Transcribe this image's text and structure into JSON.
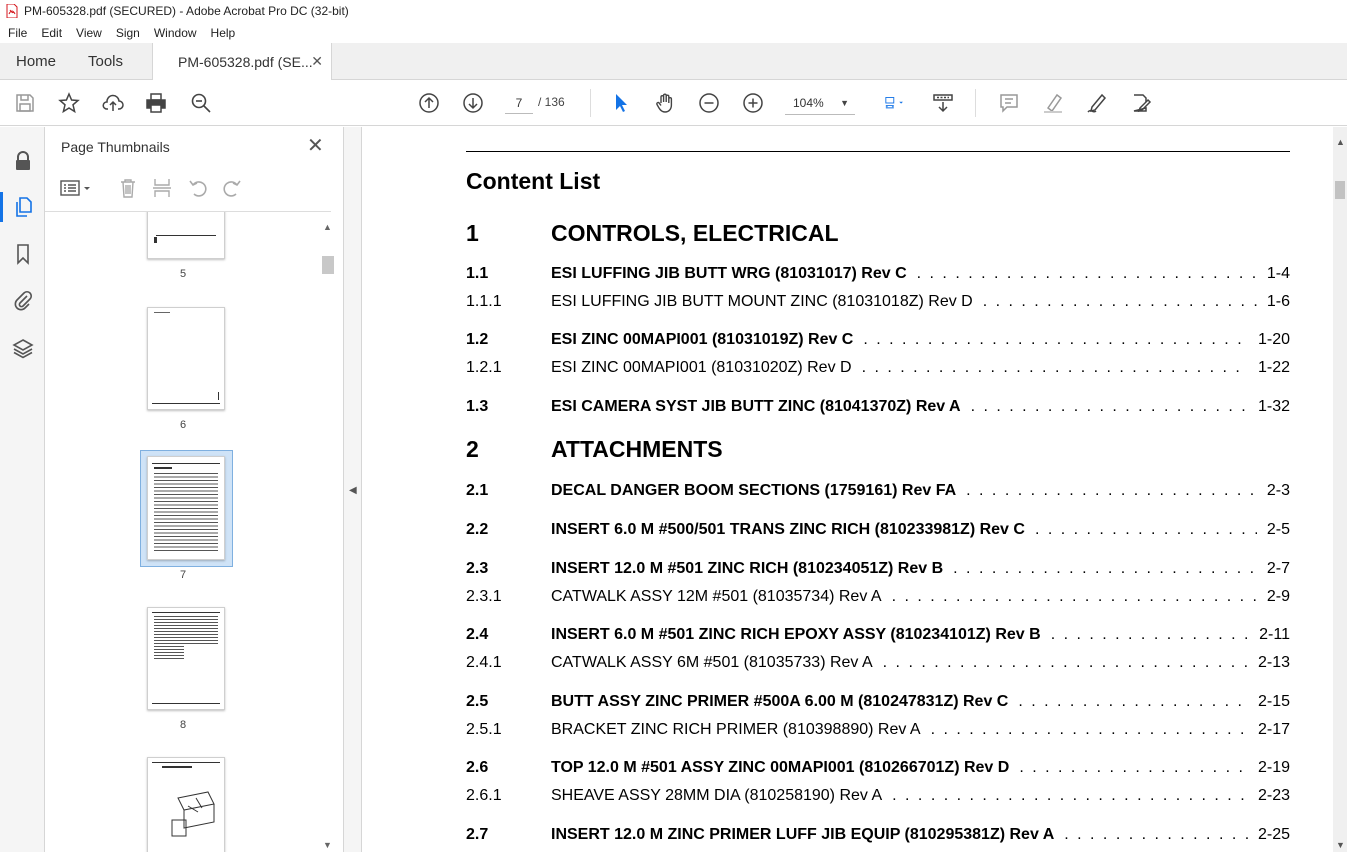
{
  "window": {
    "title": "PM-605328.pdf (SECURED) - Adobe Acrobat Pro DC (32-bit)"
  },
  "menu": [
    "File",
    "Edit",
    "View",
    "Sign",
    "Window",
    "Help"
  ],
  "tabs": {
    "home": "Home",
    "tools": "Tools",
    "doc": "PM-605328.pdf (SE..."
  },
  "toolbar": {
    "page_current": "7",
    "page_total": "/ 136",
    "zoom": "104%"
  },
  "panel": {
    "title": "Page Thumbnails"
  },
  "thumbnails": [
    {
      "label": "5"
    },
    {
      "label": "6"
    },
    {
      "label": "7"
    },
    {
      "label": "8"
    }
  ],
  "document": {
    "heading": "Content List",
    "rows": [
      {
        "num": "1",
        "text": "CONTROLS, ELECTRICAL",
        "page": "",
        "style": "sec"
      },
      {
        "num": "1.1",
        "text": "ESI LUFFING JIB BUTT WRG (81031017) Rev C",
        "page": "1-4",
        "style": "r1"
      },
      {
        "num": "1.1.1",
        "text": "ESI LUFFING JIB BUTT MOUNT ZINC (81031018Z) Rev D",
        "page": "1-6",
        "style": "r2"
      },
      {
        "num": "1.2",
        "text": "ESI ZINC 00MAPI001 (81031019Z) Rev C",
        "page": "1-20",
        "style": "r1"
      },
      {
        "num": "1.2.1",
        "text": "ESI ZINC 00MAPI001 (81031020Z) Rev D",
        "page": "1-22",
        "style": "r2"
      },
      {
        "num": "1.3",
        "text": "ESI CAMERA SYST JIB BUTT ZINC (81041370Z) Rev A",
        "page": "1-32",
        "style": "r1"
      },
      {
        "num": "2",
        "text": "ATTACHMENTS",
        "page": "",
        "style": "sec"
      },
      {
        "num": "2.1",
        "text": "DECAL DANGER BOOM SECTIONS (1759161) Rev FA",
        "page": "2-3",
        "style": "r1"
      },
      {
        "num": "2.2",
        "text": "INSERT 6.0 M #500/501 TRANS ZINC RICH (810233981Z) Rev C",
        "page": "2-5",
        "style": "r1"
      },
      {
        "num": "2.3",
        "text": "INSERT 12.0 M #501 ZINC RICH (810234051Z) Rev B",
        "page": "2-7",
        "style": "r1"
      },
      {
        "num": "2.3.1",
        "text": "CATWALK ASSY 12M #501 (81035734) Rev A",
        "page": "2-9",
        "style": "r2"
      },
      {
        "num": "2.4",
        "text": "INSERT 6.0 M #501 ZINC RICH EPOXY ASSY (810234101Z) Rev B",
        "page": "2-11",
        "style": "r1"
      },
      {
        "num": "2.4.1",
        "text": "CATWALK ASSY 6M #501 (81035733) Rev A",
        "page": "2-13",
        "style": "r2"
      },
      {
        "num": "2.5",
        "text": "BUTT ASSY ZINC PRIMER #500A 6.00 M (810247831Z) Rev C",
        "page": "2-15",
        "style": "r1"
      },
      {
        "num": "2.5.1",
        "text": "BRACKET ZINC RICH PRIMER (810398890) Rev A",
        "page": "2-17",
        "style": "r2"
      },
      {
        "num": "2.6",
        "text": "TOP 12.0 M #501 ASSY ZINC 00MAPI001 (810266701Z) Rev D",
        "page": "2-19",
        "style": "r1"
      },
      {
        "num": "2.6.1",
        "text": "SHEAVE ASSY 28MM DIA (810258190) Rev A",
        "page": "2-23",
        "style": "r2"
      },
      {
        "num": "2.7",
        "text": "INSERT 12.0 M ZINC PRIMER LUFF JIB EQUIP (810295381Z) Rev A",
        "page": "2-25",
        "style": "r1"
      }
    ]
  },
  "colors": {
    "accent": "#1473e6",
    "pdf_red": "#d4161c",
    "selected_thumb": "#cfe3f7"
  }
}
